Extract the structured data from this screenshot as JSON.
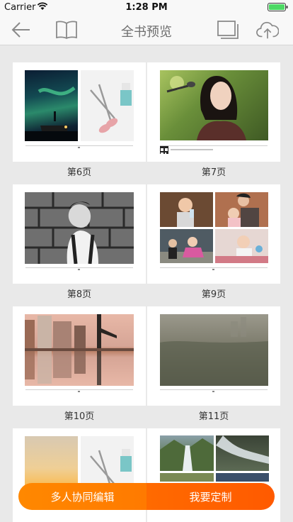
{
  "status": {
    "carrier": "Carrier",
    "time": "1:28 PM"
  },
  "nav": {
    "title": "全书预览",
    "back_icon": "back-arrow-icon",
    "book_icon": "open-book-icon",
    "pages_icon": "page-stack-icon",
    "upload_icon": "cloud-upload-icon"
  },
  "pages": [
    {
      "label": "第6页"
    },
    {
      "label": "第7页"
    },
    {
      "label": "第8页"
    },
    {
      "label": "第9页"
    },
    {
      "label": "第10页"
    },
    {
      "label": "第11页"
    }
  ],
  "actions": {
    "collab_label": "多人协同编辑",
    "customize_label": "我要定制"
  },
  "colors": {
    "accent": "#ff7a00",
    "accent_dark": "#ff5a00",
    "nav_text": "#6e6e6e",
    "battery": "#4cd964"
  }
}
